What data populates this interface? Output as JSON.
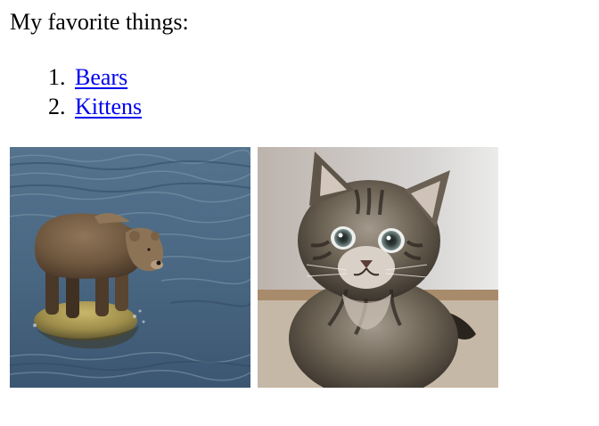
{
  "heading": "My favorite things:",
  "list": {
    "items": [
      {
        "number": "1.",
        "label": "Bears"
      },
      {
        "number": "2.",
        "label": "Kittens"
      }
    ]
  },
  "images": [
    {
      "subject": "brown bear standing on rock in river",
      "icon": "bear-photo"
    },
    {
      "subject": "tabby kitten",
      "icon": "kitten-photo"
    }
  ],
  "colors": {
    "link": "#0000ee",
    "text": "#000000",
    "background": "#ffffff",
    "water": "#4f6c86",
    "bear_fur": "#7a6146",
    "kitten_fur": "#6d6355",
    "kitten_background": "#c6b8a6"
  }
}
